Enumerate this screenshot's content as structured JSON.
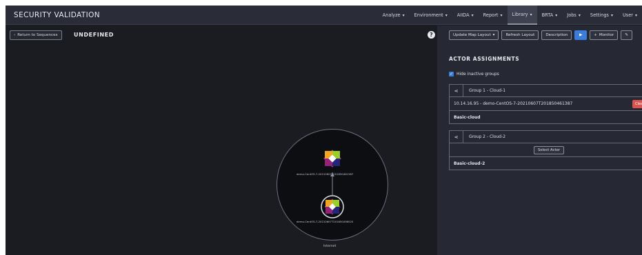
{
  "app": {
    "title": "SECURITY VALIDATION"
  },
  "nav": [
    {
      "label": "Analyze",
      "active": false
    },
    {
      "label": "Environment",
      "active": false
    },
    {
      "label": "AIIDA",
      "active": false
    },
    {
      "label": "Report",
      "active": false
    },
    {
      "label": "Library",
      "active": true
    },
    {
      "label": "BRTA",
      "active": false
    },
    {
      "label": "Jobs",
      "active": false
    },
    {
      "label": "Settings",
      "active": false
    },
    {
      "label": "User",
      "active": false
    }
  ],
  "header": {
    "back_label": "Return to Sequences",
    "sequence_title": "UNDEFINED"
  },
  "toolbar": {
    "update_map_label": "Update Map Layout",
    "refresh_label": "Refresh Layout",
    "description_label": "Description",
    "monitor_label": "Monitor"
  },
  "diagram": {
    "node_top_label": "demo-CentOS-7-20210607T201850461387",
    "node_bottom_label": "demo-CentOS-7-20210607T201850496520",
    "network_label": "Internet"
  },
  "panel": {
    "title": "ACTOR ASSIGNMENTS",
    "hide_inactive_label": "Hide inactive groups",
    "hide_inactive_checked": true,
    "groups": [
      {
        "name": "Group 1 - Cloud-1",
        "actor": "10.14.16.95 - demo-CentOS-7-20210607T201850461387",
        "clear_label": "Clear",
        "footer": "Basic-cloud"
      },
      {
        "name": "Group 2 - Cloud-2",
        "select_label": "Select Actor",
        "footer": "Basic-cloud-2"
      }
    ]
  },
  "colors": {
    "background": "#1b1c22",
    "topbar": "#2a2d38",
    "panel": "#262833",
    "primary": "#3b7dd8",
    "danger": "#d9534f"
  }
}
